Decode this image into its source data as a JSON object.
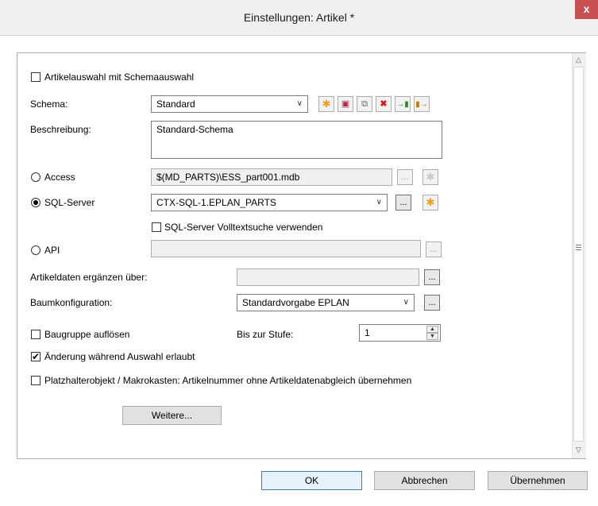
{
  "window": {
    "title": "Einstellungen: Artikel *",
    "close_glyph": "x"
  },
  "form": {
    "schema_select_checkbox": {
      "label": "Artikelauswahl mit Schemaauswahl",
      "checked": false
    },
    "schema": {
      "label": "Schema:",
      "value": "Standard"
    },
    "schema_toolbar": [
      "new-icon",
      "save-icon",
      "copy-icon",
      "delete-icon",
      "import-icon",
      "export-icon"
    ],
    "description": {
      "label": "Beschreibung:",
      "value": "Standard-Schema"
    },
    "access": {
      "label": "Access",
      "selected": false,
      "path": "$(MD_PARTS)\\ESS_part001.mdb",
      "browse": "..."
    },
    "sql_server": {
      "label": "SQL-Server",
      "selected": true,
      "value": "CTX-SQL-1.EPLAN_PARTS",
      "browse": "..."
    },
    "fulltext": {
      "label": "SQL-Server Volltextsuche verwenden",
      "checked": false
    },
    "api": {
      "label": "API",
      "selected": false,
      "value": "",
      "browse": "..."
    },
    "supplement": {
      "label": "Artikeldaten ergänzen über:",
      "value": "",
      "browse": "..."
    },
    "tree_config": {
      "label": "Baumkonfiguration:",
      "value": "Standardvorgabe EPLAN",
      "browse": "..."
    },
    "resolve_assembly": {
      "label": "Baugruppe auflösen",
      "checked": false
    },
    "level": {
      "label": "Bis zur Stufe:",
      "value": "1"
    },
    "change_during_selection": {
      "label": "Änderung während Auswahl erlaubt",
      "checked": true
    },
    "placeholder": {
      "label": "Platzhalterobjekt / Makrokasten: Artikelnummer ohne Artikeldatenabgleich übernehmen",
      "checked": false
    },
    "more_button": "Weitere..."
  },
  "footer": {
    "ok": "OK",
    "cancel": "Abbrechen",
    "apply": "Übernehmen"
  }
}
